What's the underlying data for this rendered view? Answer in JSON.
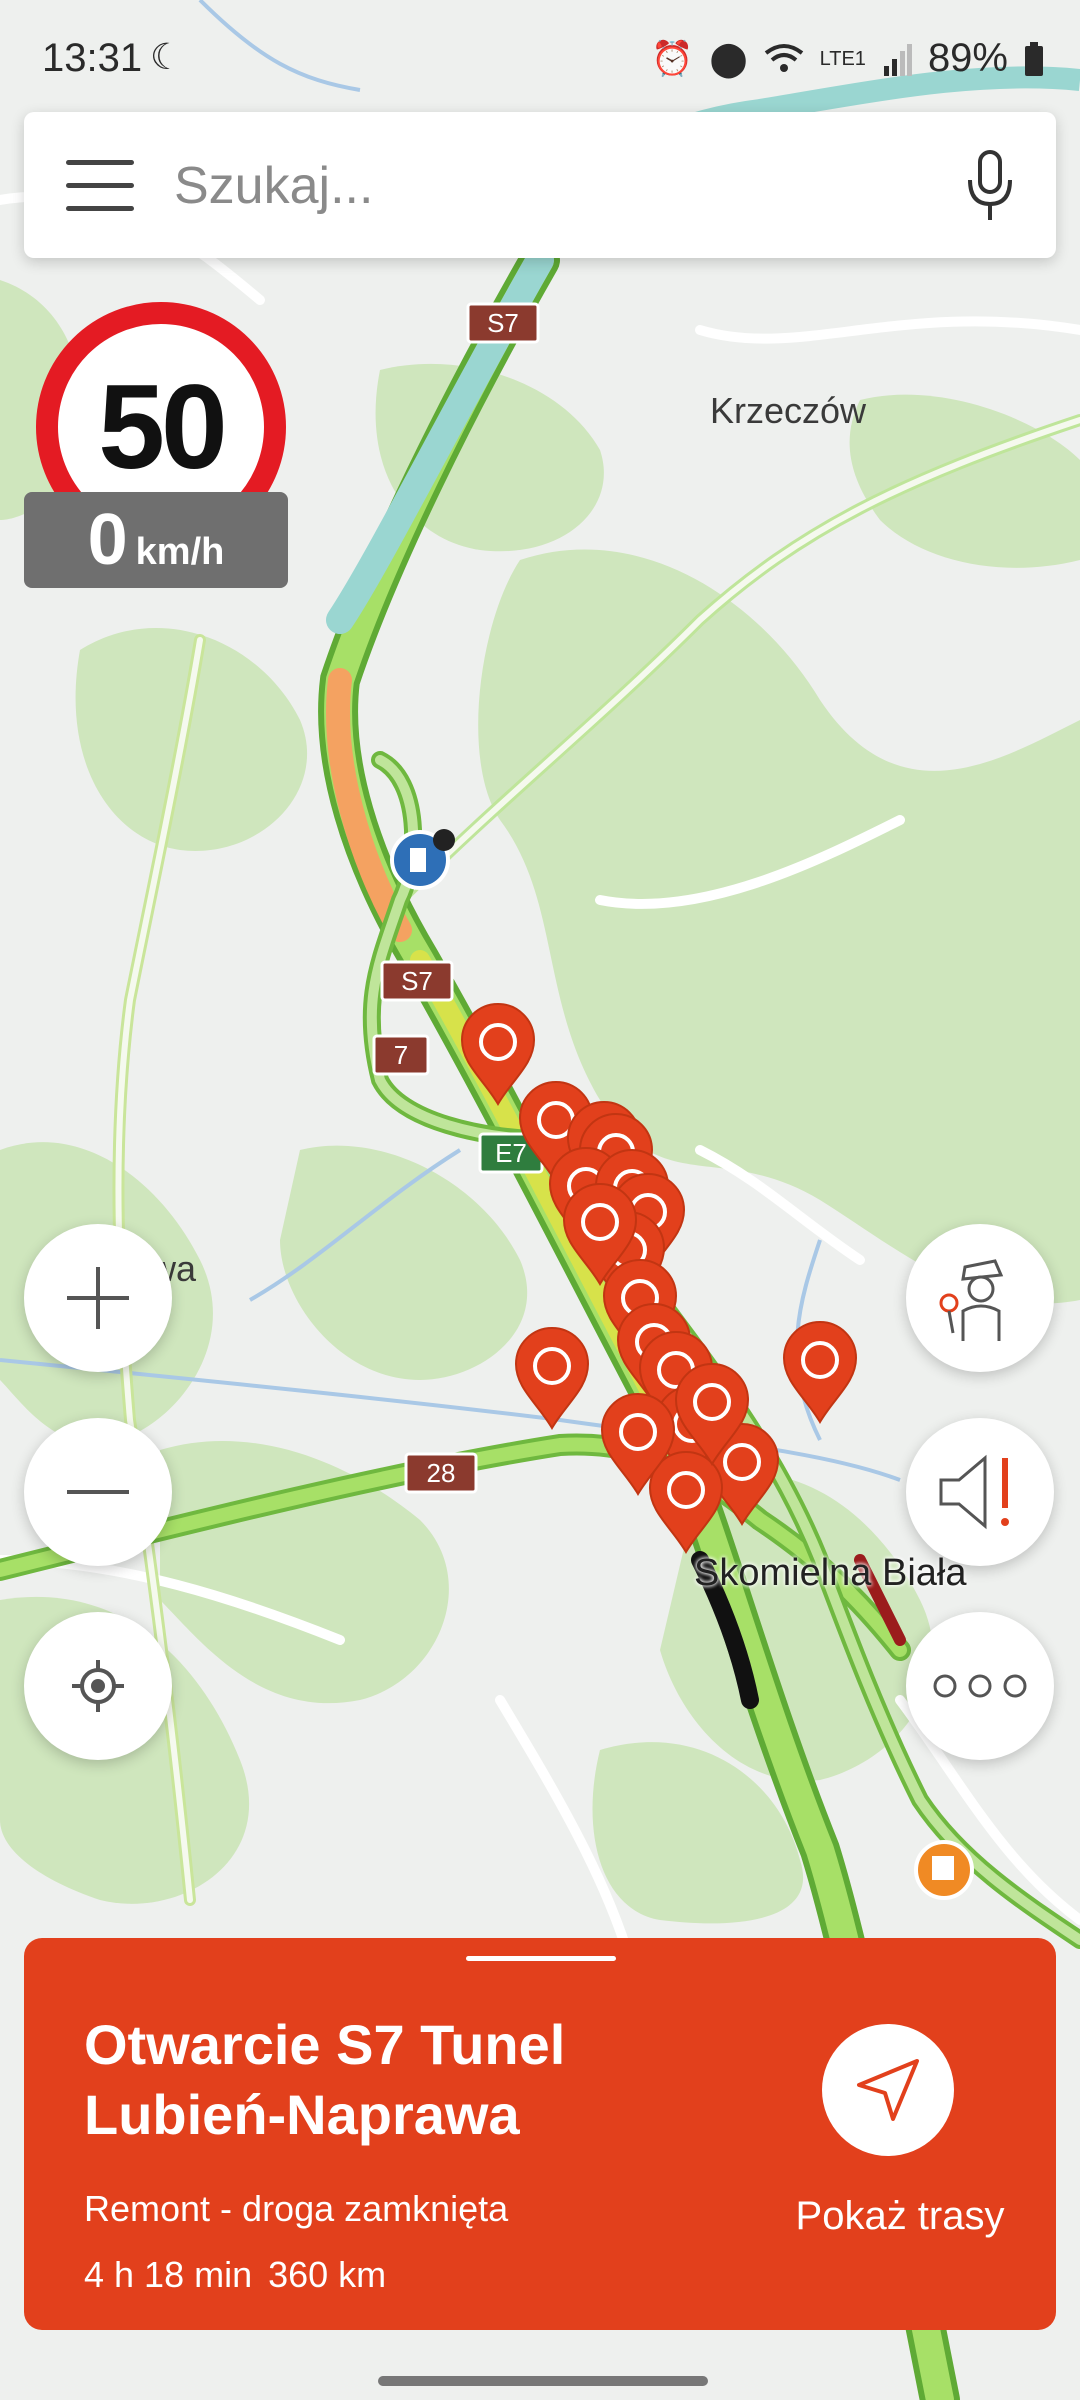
{
  "status_bar": {
    "time": "13:31",
    "battery": "89%",
    "network_label": "LTE1",
    "icons": [
      "crescent-icon",
      "alarm-icon",
      "location-icon",
      "wifi-icon",
      "signal-icon",
      "battery-icon"
    ]
  },
  "search": {
    "placeholder": "Szukaj..."
  },
  "speed": {
    "limit": "50",
    "current": "0",
    "unit": "km/h"
  },
  "map": {
    "place_labels": {
      "krzeczow": "Krzeczów",
      "skomielna": "Skomielna Biała",
      "partial_left": "wa"
    },
    "road_shields": {
      "s7_top": "S7",
      "s7_mid": "S7",
      "r7": "7",
      "e7": "E7",
      "r28": "28"
    },
    "incident_marker_count": 15,
    "colors": {
      "marker": "#e2401c",
      "traffic_green": "#7ed957",
      "traffic_yellow": "#d7e24a",
      "traffic_orange": "#f4a261",
      "forest": "#c9e3b6",
      "road": "#ffffff"
    }
  },
  "controls": {
    "zoom_in": "zoom-in",
    "zoom_out": "zoom-out",
    "locate": "locate",
    "police": "police",
    "sound": "sound",
    "more": "more"
  },
  "sheet": {
    "title_line1": "Otwarcie S7 Tunel",
    "title_line2": "Lubień-Naprawa",
    "subtitle": "Remont - droga zamknięta",
    "duration": "4 h 18 min",
    "distance": "360 km",
    "action_label": "Pokaż trasy",
    "color": "#e2401c"
  }
}
